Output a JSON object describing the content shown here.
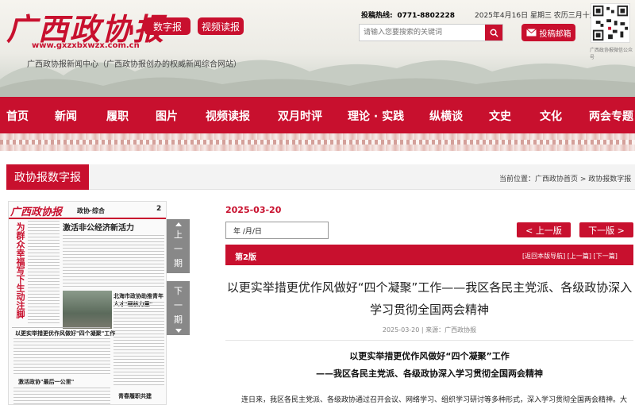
{
  "header": {
    "logo": "广西政协报",
    "url": "www.gxzxbxwzx.com.cn",
    "tagline": "广西政协报新闻中心（广西政协报创办的权威新闻综合网站）",
    "btn_digital": "数字报",
    "btn_video": "视频读报",
    "hotline_label": "投稿热线:",
    "hotline_number": "0771-8802228",
    "date": "2025年4月16日  星期三  农历三月十九",
    "search_placeholder": "请输入您要搜索的关键词",
    "mail_label": "投稿邮箱",
    "qr_caption": "广西政协报微信公众号"
  },
  "nav": [
    "首页",
    "新闻",
    "履职",
    "图片",
    "视频读报",
    "双月时评",
    "理论 · 实践",
    "纵横谈",
    "文史",
    "文化",
    "两会专题"
  ],
  "section": {
    "title": "政协报数字报",
    "breadcrumb": "当前位置：广西政协首页 > 政协报数字报"
  },
  "newspaper": {
    "logo": "广西政协报",
    "section": "政协·综合",
    "page_no": "2",
    "vhead": "为群众幸福写下生动注脚",
    "h1": "激活非公经济新活力",
    "h2": "北海市政协助推青年人才\"硬核力量\"",
    "h3": "以更实举措更优作风做好\"四个凝聚\"工作",
    "h4": "激活政协\"最后一公里\"",
    "h5": "青春履职共建"
  },
  "period": {
    "prev": [
      "上",
      "一",
      "期"
    ],
    "next": [
      "下",
      "一",
      "期"
    ]
  },
  "issue": {
    "date": "2025-03-20",
    "date_input": "年 /月/日",
    "prev_page": "< 上一版",
    "next_page": "下一版 >",
    "edition": "第2版",
    "edition_nav": "[返回本版导航]  [上一篇]  [下一篇]"
  },
  "article": {
    "title": "以更实举措更优作风做好“四个凝聚”工作——我区各民主党派、各级政协深入学习贯彻全国两会精神",
    "meta": "2025-03-20 | 来源：广西政协报",
    "sub1": "以更实举措更优作风做好“四个凝聚”工作",
    "sub2": "——我区各民主党派、各级政协深入学习贯彻全国两会精神",
    "body": "连日来，我区各民主党派、各级政协通过召开会议、网络学习、组织学习研讨等多种形式，深入学习贯彻全国两会精神。大"
  }
}
